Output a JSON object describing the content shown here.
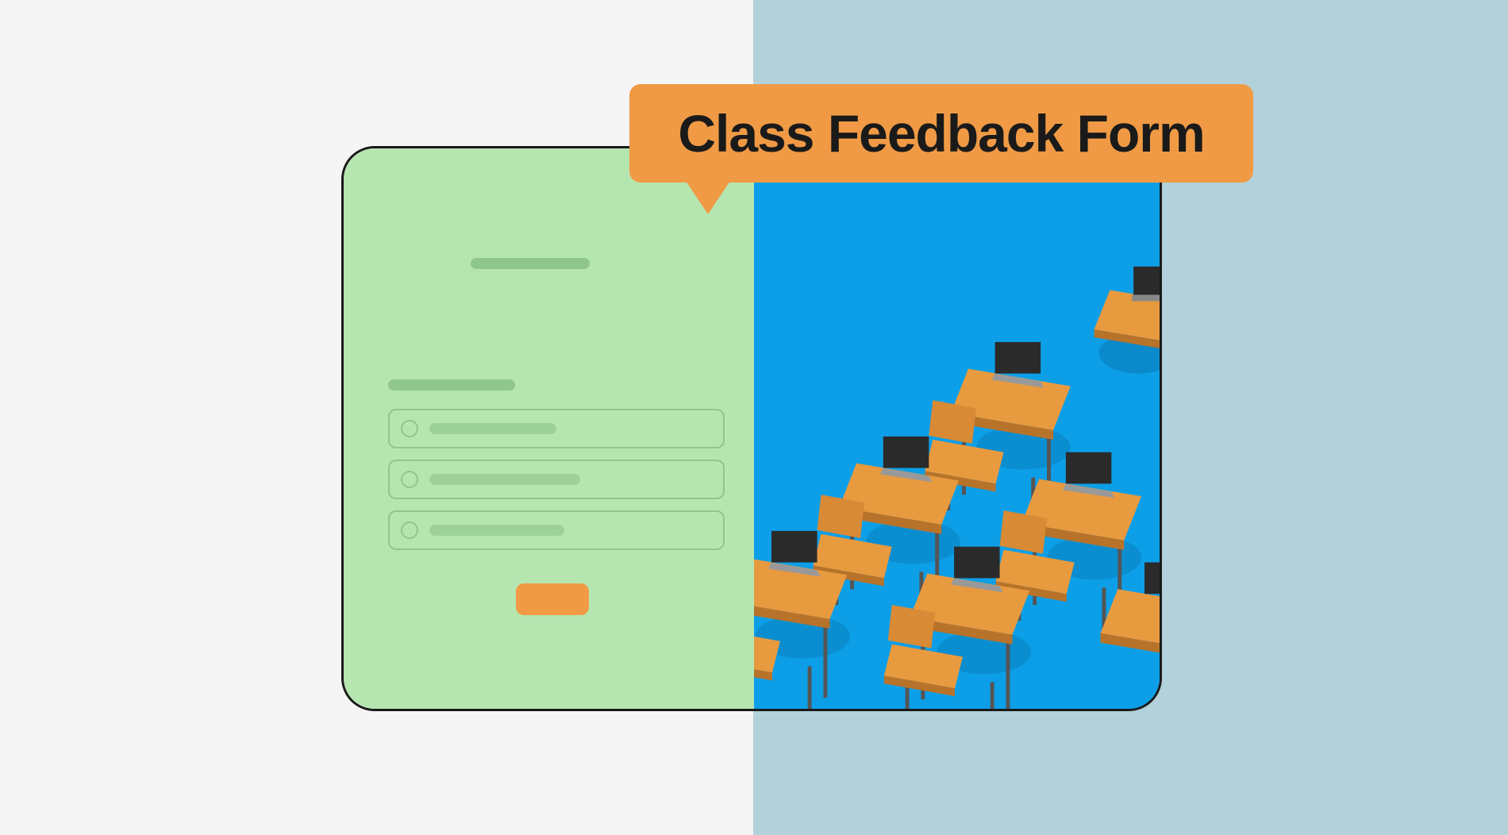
{
  "callout": {
    "title": "Class Feedback Form"
  },
  "colors": {
    "accent": "#f09a45",
    "form_bg": "#b6e6b0",
    "image_bg": "#0c9fe8",
    "page_right": "#b3d1db",
    "page_left": "#f5f5f5"
  }
}
